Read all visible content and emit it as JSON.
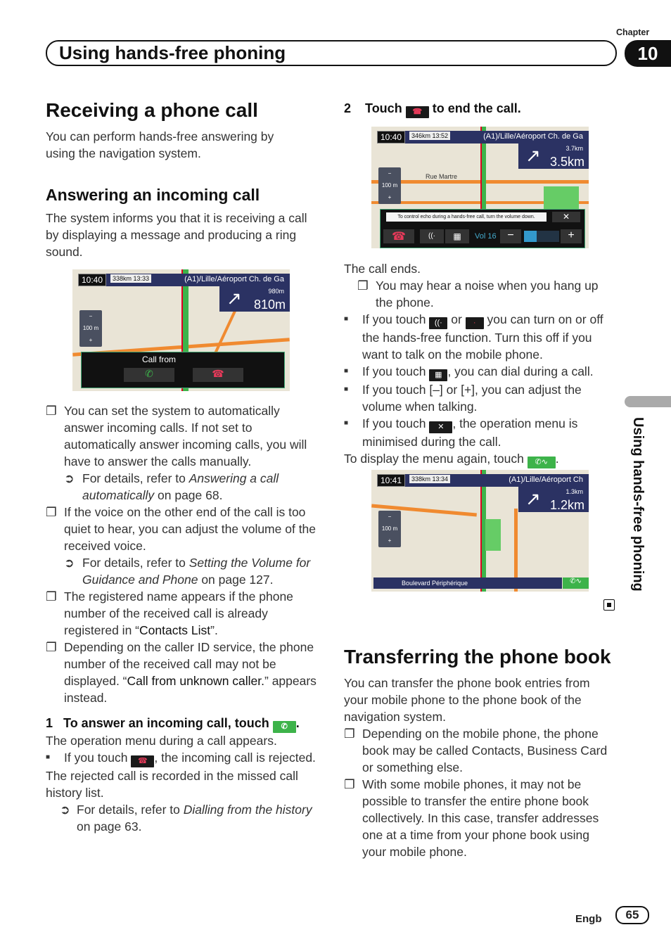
{
  "header": {
    "title": "Using hands-free phoning",
    "chapter_label": "Chapter",
    "chapter_number": "10",
    "side_tab": "Using hands-free phoning"
  },
  "left": {
    "h1": "Receiving a phone call",
    "intro": "You can perform hands-free answering by using the navigation system.",
    "h2": "Answering an incoming call",
    "p1": "The system informs you that it is receiving a call by displaying a message and producing a ring sound.",
    "map1": {
      "time": "10:40",
      "dist": "338km 13:33",
      "dest": "(A1)/Lille/Aéroport Ch. de Ga",
      "sub": "980m",
      "main": "810m",
      "scale": "100 m",
      "call_from": "Call from"
    },
    "notes": [
      "You can set the system to automatically answer incoming calls. If not set to automatically answer incoming calls, you will have to answer the calls manually.",
      "If the voice on the other end of the call is too quiet to hear, you can adjust the volume of the received voice."
    ],
    "refs": [
      {
        "pre": "For details, refer to ",
        "it": "Answering a call automatically",
        "post": " on page 68."
      },
      {
        "pre": "For details, refer to ",
        "it": "Setting the Volume for Guidance and Phone",
        "post": " on page 127."
      }
    ],
    "note3": {
      "pre": "The registered name appears if the phone number of the received call is already registered in “",
      "b": "Contacts List",
      "post": "”."
    },
    "note4": {
      "pre": "Depending on the caller ID service, the phone number of the received call may not be displayed. “",
      "b": "Call from unknown caller.",
      "post": "” appears instead."
    },
    "step1": {
      "num": "1",
      "text": "To answer an incoming call, touch"
    },
    "s1p": "The operation menu during a call appears.",
    "s1b": {
      "pre": "If you touch",
      "post": ", the incoming call is rejected."
    },
    "s1p2": "The rejected call is recorded in the missed call history list.",
    "s1ref": {
      "pre": "For details, refer to ",
      "it": "Dialling from the history",
      "post": " on page 63."
    }
  },
  "right": {
    "step2": {
      "num": "2",
      "pre": "Touch",
      "post": "to end the call."
    },
    "map2": {
      "time": "10:40",
      "dist": "346km 13:52",
      "dest": "(A1)/Lille/Aéroport Ch. de Ga",
      "sub": "3.7km",
      "main": "3.5km",
      "scale": "100 m",
      "street": "Rue Martre",
      "msg": "To control echo during a hands-free call, turn the volume down.",
      "vol": "Vol 16",
      "volume_level": 16
    },
    "p_ends": "The call ends.",
    "note_noise": "You may hear a noise when you hang up the phone.",
    "b1": {
      "pre": "If you touch",
      "mid": "or",
      "post": "you can turn on or off the hands-free function. Turn this off if you want to talk on the mobile phone."
    },
    "b2": {
      "pre": "If you touch",
      "post": ", you can dial during a call."
    },
    "b3": {
      "text": "If you touch [–] or [+], you can adjust the volume when talking."
    },
    "b4": {
      "pre": "If you touch",
      "post": ", the operation menu is minimised during the call."
    },
    "p_display": "To display the menu again, touch",
    "map3": {
      "time": "10:41",
      "dist": "338km 13:34",
      "dest": "(A1)/Lille/Aéroport Ch",
      "sub": "1.3km",
      "main": "1.2km",
      "scale": "100 m",
      "street": "Boulevard Périphérique"
    },
    "h1": "Transferring the phone book",
    "p_transfer": "You can transfer the phone book entries from your mobile phone to the phone book of the navigation system.",
    "notes": [
      "Depending on the mobile phone, the phone book may be called Contacts, Business Card or something else.",
      "With some mobile phones, it may not be possible to transfer the entire phone book collectively. In this case, transfer addresses one at a time from your phone book using your mobile phone."
    ]
  },
  "footer": {
    "lang": "Engb",
    "page": "65"
  },
  "icons": {
    "note": "❐",
    "ref": "➲",
    "bullet": "■"
  }
}
